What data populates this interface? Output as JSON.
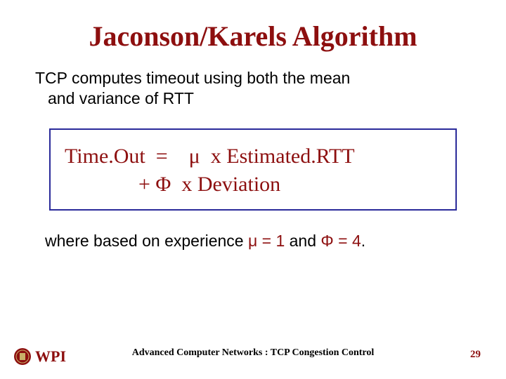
{
  "title": "Jaconson/Karels Algorithm",
  "subtitle_line1": "TCP computes timeout using both the mean",
  "subtitle_line2": "and variance of RTT",
  "formula": {
    "line1": "Time.Out  =    μ  x Estimated.RTT",
    "line2": "              + Φ  x Deviation"
  },
  "closing": {
    "prefix": "where based on experience ",
    "mu": "μ = 1",
    "mid": " and  ",
    "phi": "Φ = 4",
    "suffix": "."
  },
  "footer": {
    "course": "Advanced Computer Networks : TCP Congestion Control",
    "page": "29"
  },
  "logo": {
    "alt": "WPI"
  }
}
